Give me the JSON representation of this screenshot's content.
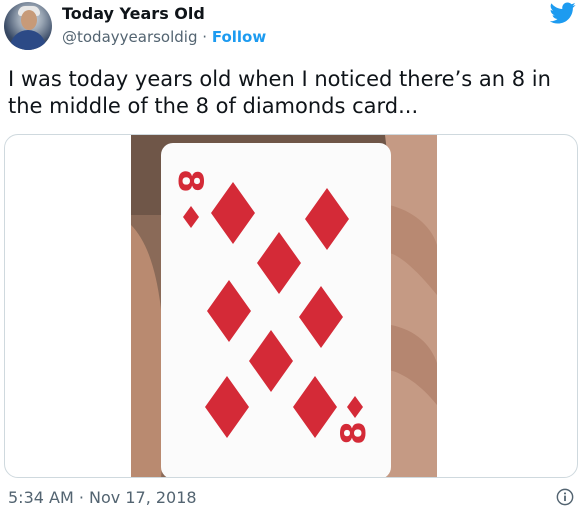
{
  "author": {
    "display_name": "Today Years Old",
    "handle": "@todayyearsoldig",
    "separator": "·",
    "follow_label": "Follow"
  },
  "tweet": {
    "text": "I was today years old when I noticed there’s an 8 in the middle of the 8 of diamonds card...",
    "timestamp": "5:34 AM · Nov 17, 2018"
  },
  "card": {
    "rank": "8",
    "suit": "diamonds"
  },
  "icons": {
    "brand": "twitter-bird-icon",
    "info": "info-icon"
  },
  "colors": {
    "accent": "#1d9bf0",
    "suit_red": "#d42a37",
    "text": "#0f1419",
    "muted": "#536471"
  }
}
